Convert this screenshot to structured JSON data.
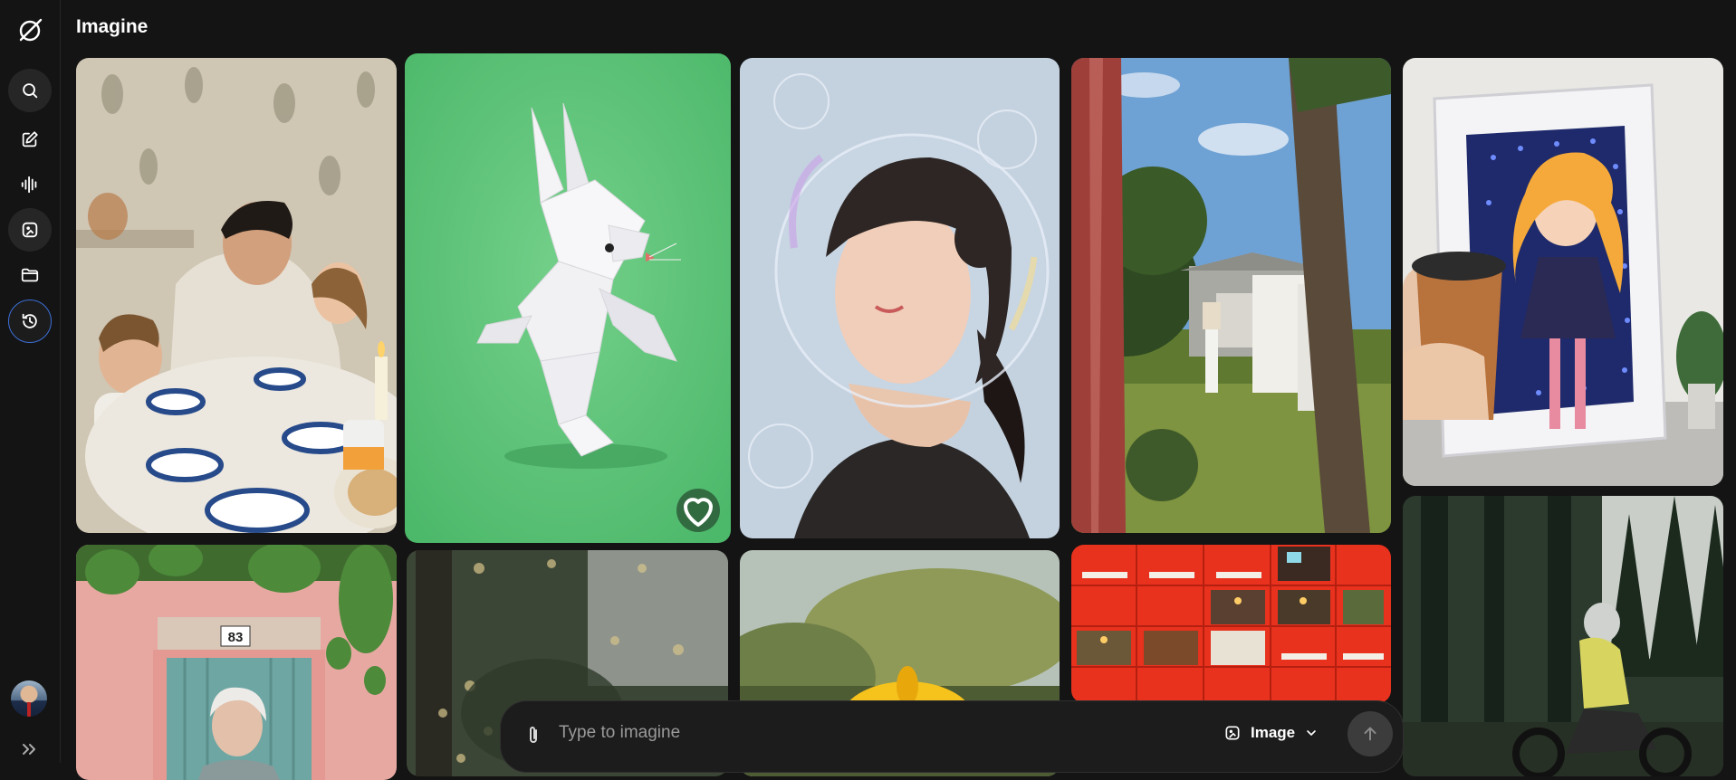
{
  "app": {
    "title": "Imagine"
  },
  "sidebar": {
    "items": [
      {
        "name": "search",
        "icon": "search-icon"
      },
      {
        "name": "new-chat",
        "icon": "edit-icon"
      },
      {
        "name": "voice",
        "icon": "waveform-icon"
      },
      {
        "name": "imagine",
        "icon": "image-icon"
      },
      {
        "name": "projects",
        "icon": "folder-icon"
      },
      {
        "name": "history",
        "icon": "history-icon"
      }
    ],
    "expand_icon": "chevrons-right-icon"
  },
  "gallery": {
    "tiles": [
      {
        "subject": "family-breakfast"
      },
      {
        "subject": "origami-rabbit"
      },
      {
        "subject": "woman-in-bubble"
      },
      {
        "subject": "garden-laundry"
      },
      {
        "subject": "anime-portal-coffee"
      },
      {
        "subject": "elderly-woman-doorway",
        "sign": "83"
      },
      {
        "subject": "bokeh-forest"
      },
      {
        "subject": "yellow-flower"
      },
      {
        "subject": "red-lockers"
      },
      {
        "subject": "forest-motorbike"
      }
    ]
  },
  "composer": {
    "placeholder": "Type to imagine",
    "mode_label": "Image",
    "mode_icon": "image-icon",
    "attach_icon": "paperclip-icon",
    "send_icon": "arrow-up-icon"
  },
  "colors": {
    "background": "#141414",
    "active_border": "#3b6fd8",
    "panel": "#1c1c1c"
  }
}
